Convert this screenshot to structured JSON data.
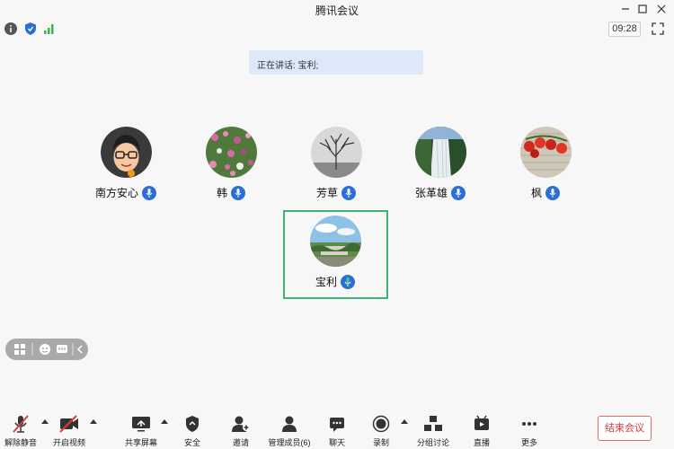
{
  "window": {
    "title": "腾讯会议"
  },
  "status": {
    "timer": "09:28"
  },
  "speaking": {
    "text": "正在讲话: 宝利;"
  },
  "participants": [
    {
      "name": "南方安心",
      "icon": "cartoon-glasses-avatar"
    },
    {
      "name": "韩",
      "icon": "flowers-avatar"
    },
    {
      "name": "芳草",
      "icon": "bare-tree-avatar"
    },
    {
      "name": "张革雄",
      "icon": "waterfall-avatar"
    },
    {
      "name": "枫",
      "icon": "tomatoes-avatar"
    },
    {
      "name": "宝利",
      "icon": "landscape-avatar"
    }
  ],
  "toolbar": {
    "mute": "解除静音",
    "video": "开启视频",
    "share": "共享屏幕",
    "security": "安全",
    "invite": "邀请",
    "members": "管理成员(6)",
    "chat": "聊天",
    "record": "录制",
    "breakout": "分组讨论",
    "live": "直播",
    "more": "更多",
    "end": "结束会议"
  },
  "colors": {
    "accent": "#2b6fd6",
    "active": "#3fb27a",
    "danger": "#d93b3b",
    "signal": "#3cb44b"
  }
}
